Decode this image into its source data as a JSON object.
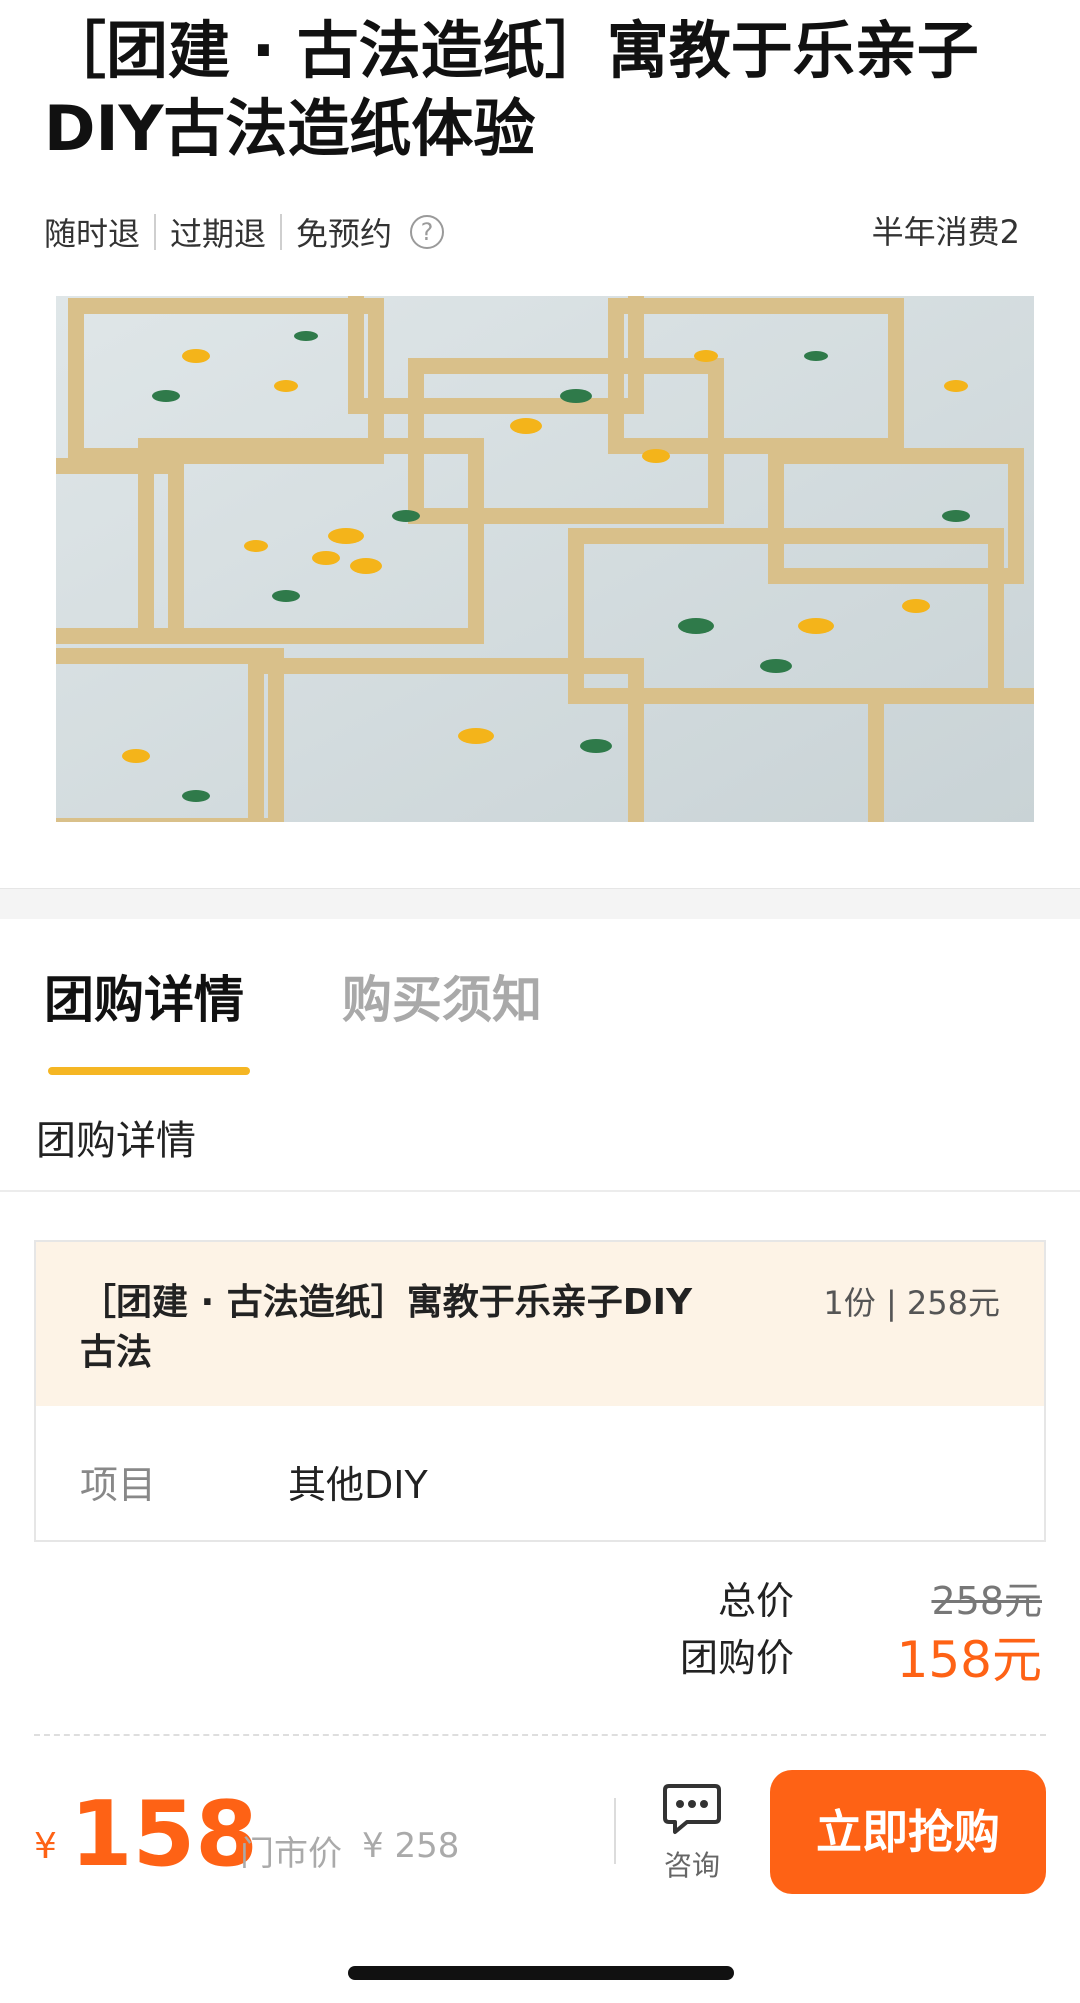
{
  "product": {
    "title": "［团建 · 古法造纸］寓教于乐亲子DIY古法造纸体验",
    "tags": [
      "随时退",
      "过期退",
      "免预约"
    ],
    "sales": "半年消费2"
  },
  "tabs": [
    {
      "label": "团购详情",
      "active": true
    },
    {
      "label": "购买须知",
      "active": false
    }
  ],
  "section": {
    "title": "团购详情"
  },
  "deal": {
    "name": "［团建 · 古法造纸］寓教于乐亲子DIY古法",
    "quantity_price": "1份 | 258元",
    "item_label": "项目",
    "item_value": "其他DIY"
  },
  "pricing": {
    "total_label": "总价",
    "total_value": "258元",
    "group_label": "团购价",
    "group_value": "158元"
  },
  "bottom_bar": {
    "currency": "¥",
    "price": "158",
    "market_label": "门市价",
    "market_price": "¥ 258",
    "consult_label": "咨询",
    "buy_label": "立即抢购"
  },
  "colors": {
    "accent": "#fe6215",
    "tab_underline": "#f5b623",
    "deal_header_bg": "#fdf3e6"
  }
}
